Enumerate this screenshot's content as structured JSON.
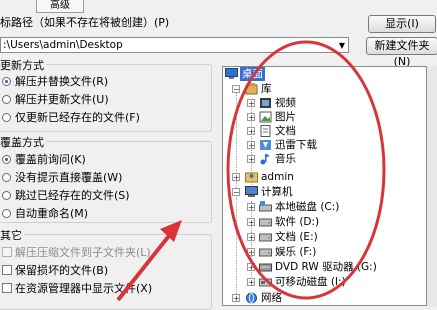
{
  "tab": {
    "label": "高级"
  },
  "path_label": "标路径（如果不存在将被创建）(P)",
  "buttons": {
    "show": "显示(I)",
    "new_folder": "新建文件夹(N)"
  },
  "path_value": ":\\Users\\admin\\Desktop",
  "update": {
    "title": "更新方式",
    "options": [
      "解压并替换文件(R)",
      "解压并更新文件(U)",
      "仅更新已经存在的文件(F)"
    ],
    "selected": 0
  },
  "overwrite": {
    "title": "覆盖方式",
    "options": [
      "覆盖前询问(K)",
      "没有提示直接覆盖(W)",
      "跳过已经存在的文件(S)",
      "自动重命名(M)"
    ],
    "selected": 0
  },
  "other": {
    "title": "其它",
    "options": [
      {
        "label": "解压压缩文件到子文件夹(L)",
        "disabled": true
      },
      {
        "label": "保留损坏的文件(B)",
        "disabled": false
      },
      {
        "label": "在资源管理器中显示文件(X)",
        "disabled": false
      }
    ]
  },
  "tree": [
    {
      "label": "桌面",
      "level": 0,
      "icon": "desktop-icon",
      "selected": true
    },
    {
      "label": "库",
      "level": 1,
      "icon": "library-icon",
      "expander": "-"
    },
    {
      "label": "视频",
      "level": 2,
      "icon": "video-icon",
      "expander": "+"
    },
    {
      "label": "图片",
      "level": 2,
      "icon": "picture-icon",
      "expander": "+"
    },
    {
      "label": "文档",
      "level": 2,
      "icon": "document-icon",
      "expander": "+"
    },
    {
      "label": "迅雷下载",
      "level": 2,
      "icon": "download-icon",
      "expander": "+"
    },
    {
      "label": "音乐",
      "level": 2,
      "icon": "music-icon",
      "expander": "+"
    },
    {
      "label": "admin",
      "level": 1,
      "icon": "user-folder-icon",
      "expander": "+"
    },
    {
      "label": "计算机",
      "level": 1,
      "icon": "computer-icon",
      "expander": "-"
    },
    {
      "label": "本地磁盘 (C:)",
      "level": 2,
      "icon": "drive-icon",
      "expander": "+"
    },
    {
      "label": "软件 (D:)",
      "level": 2,
      "icon": "drive-icon",
      "expander": "+"
    },
    {
      "label": "文档 (E:)",
      "level": 2,
      "icon": "drive-icon",
      "expander": "+"
    },
    {
      "label": "娱乐 (F:)",
      "level": 2,
      "icon": "drive-icon",
      "expander": "+"
    },
    {
      "label": "DVD RW 驱动器 (G:)",
      "level": 2,
      "icon": "dvd-drive-icon",
      "expander": "+"
    },
    {
      "label": "可移动磁盘 (I:)",
      "level": 2,
      "icon": "removable-drive-icon",
      "expander": "+"
    },
    {
      "label": "网络",
      "level": 1,
      "icon": "network-icon",
      "expander": "+"
    }
  ],
  "colors": {
    "annotation": "#d9343a",
    "selection": "#3a6fd1",
    "radio_dot": "#1b62c5"
  }
}
